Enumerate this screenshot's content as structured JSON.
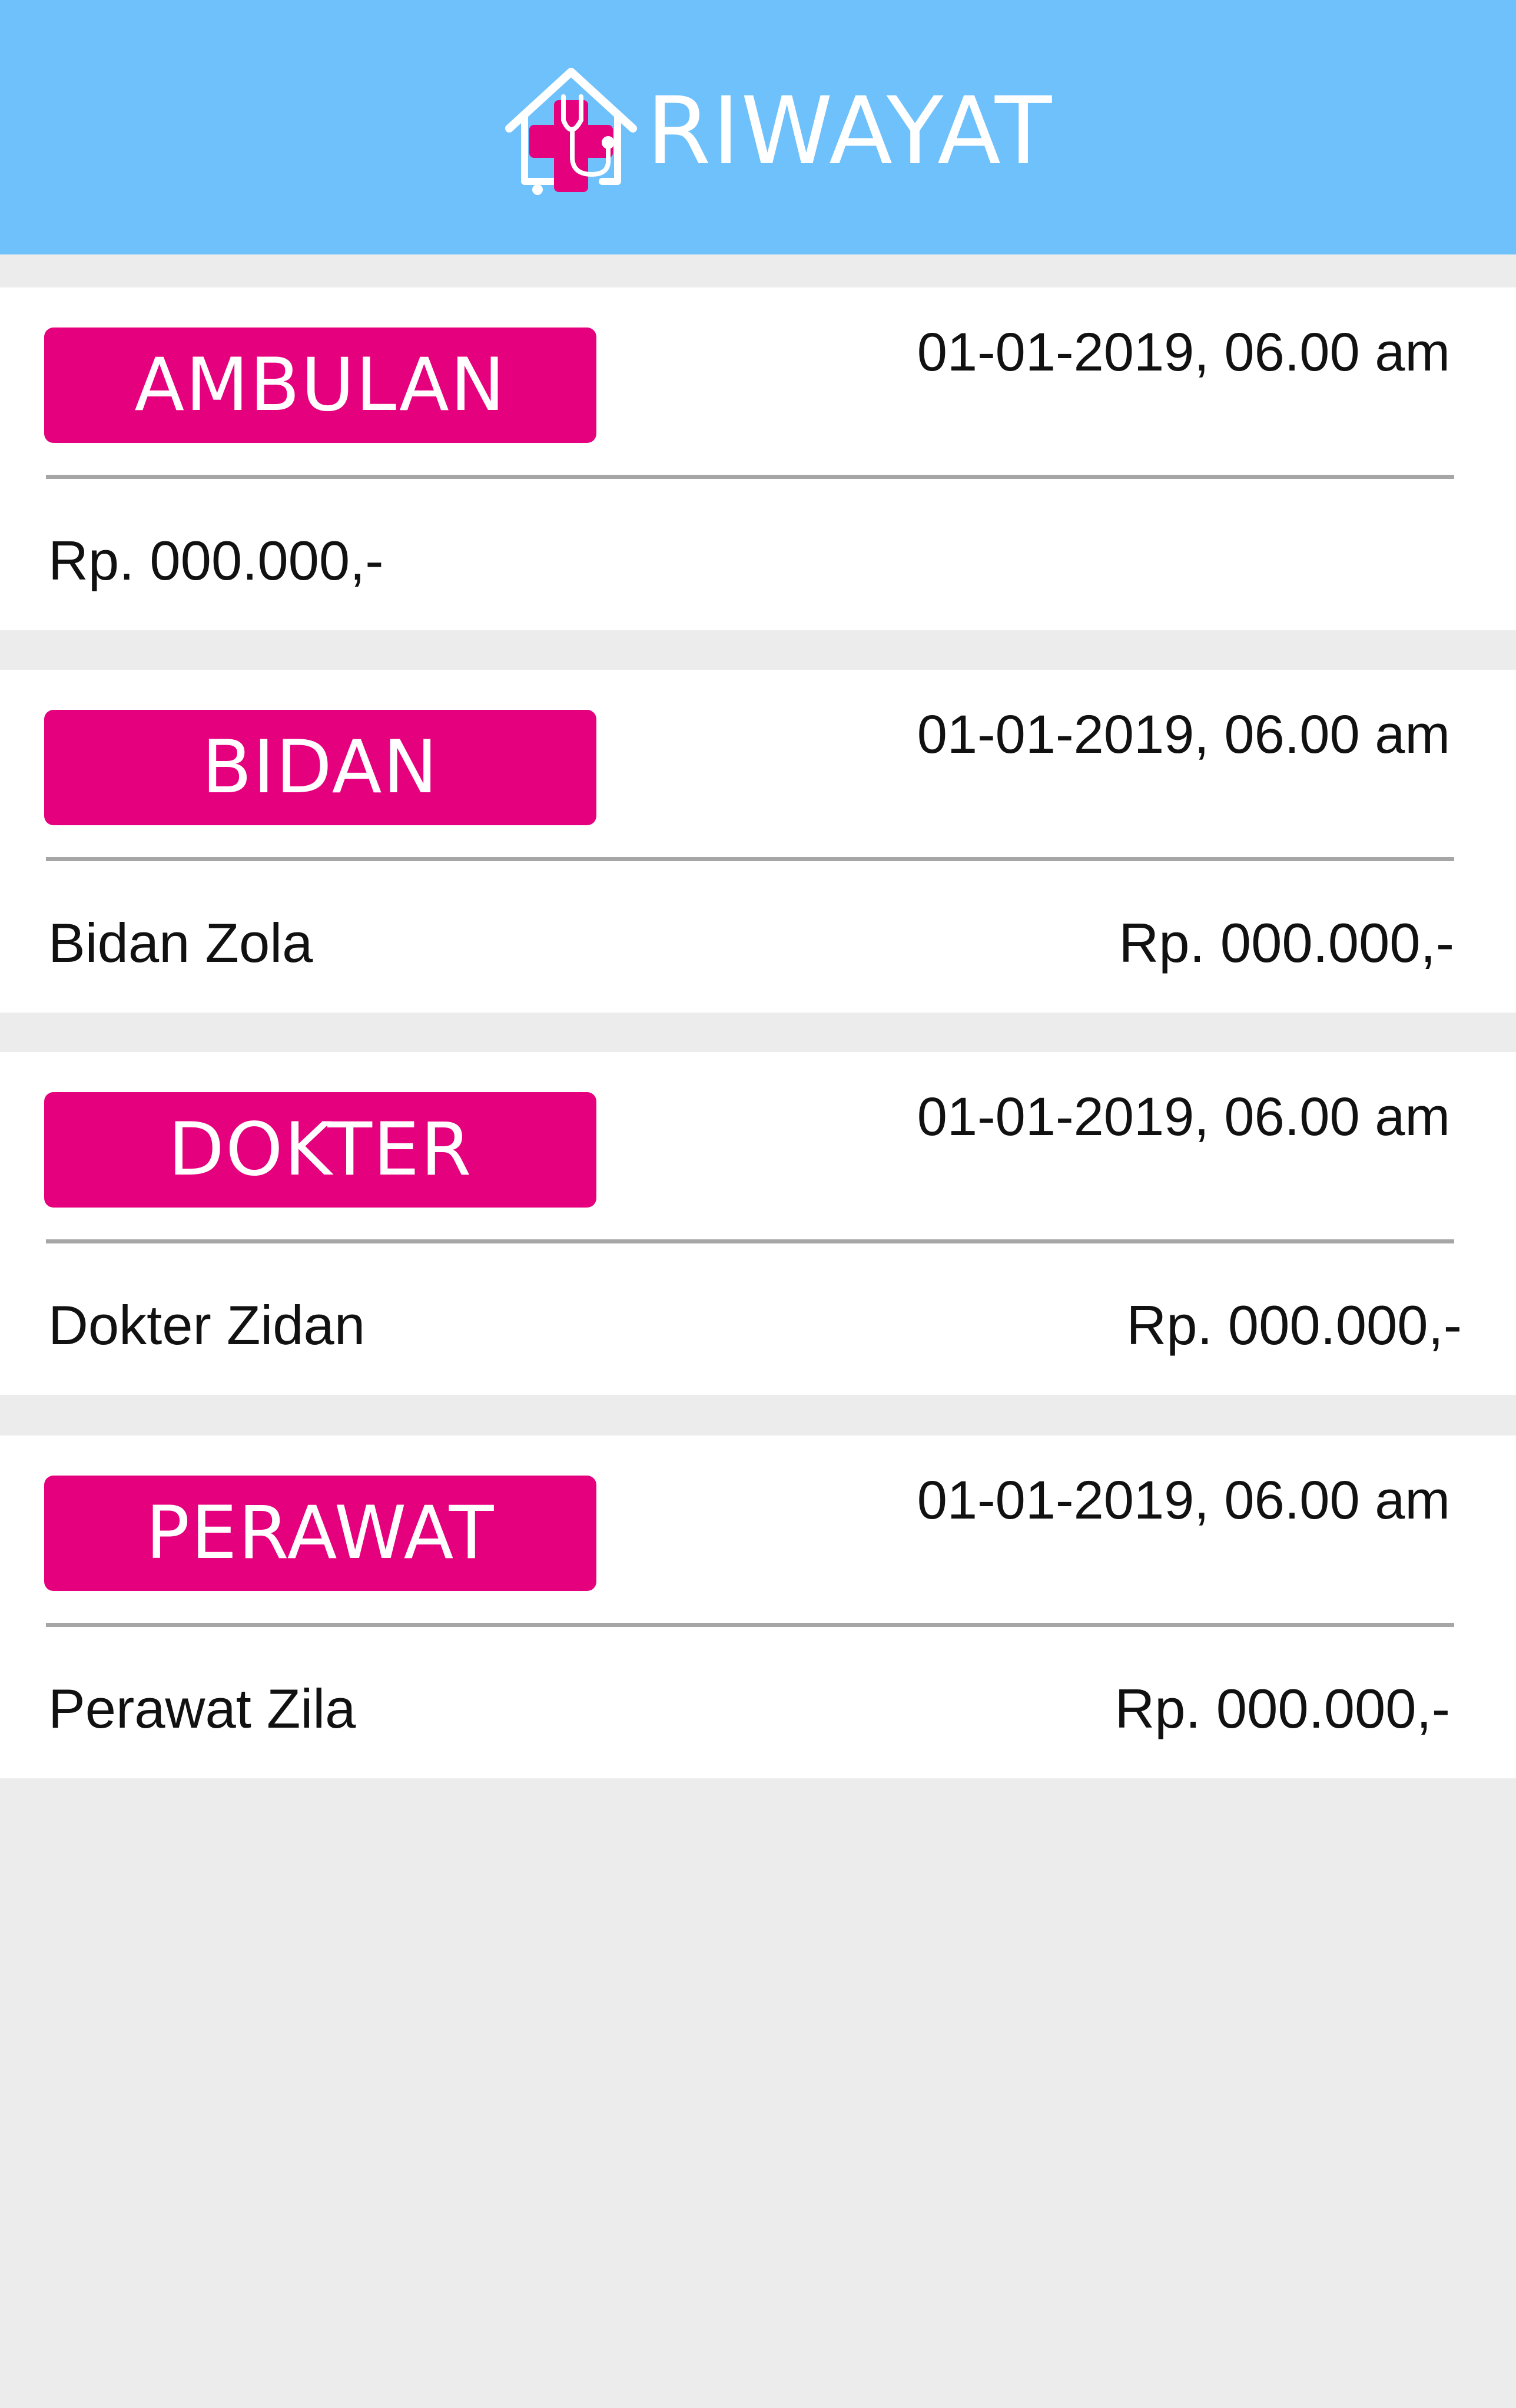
{
  "header": {
    "title": "RIWAYAT",
    "logo_icon": "house-medical-cross-stethoscope-icon",
    "background_color": "#6fc1fb"
  },
  "colors": {
    "accent": "#e5007d",
    "page_background": "#ececec",
    "card_background": "#ffffff",
    "divider": "#a6a6a6"
  },
  "history": [
    {
      "category": "AMBULAN",
      "datetime": "01-01-2019, 06.00 am",
      "name": "",
      "price": "Rp. 000.000,-"
    },
    {
      "category": "BIDAN",
      "datetime": "01-01-2019, 06.00 am",
      "name": "Bidan Zola",
      "price": "Rp. 000.000,-"
    },
    {
      "category": "DOKTER",
      "datetime": "01-01-2019, 06.00 am",
      "name": "Dokter Zidan",
      "price": "Rp. 000.000,-"
    },
    {
      "category": "PERAWAT",
      "datetime": "01-01-2019, 06.00 am",
      "name": "Perawat Zila",
      "price": "Rp. 000.000,-"
    }
  ]
}
